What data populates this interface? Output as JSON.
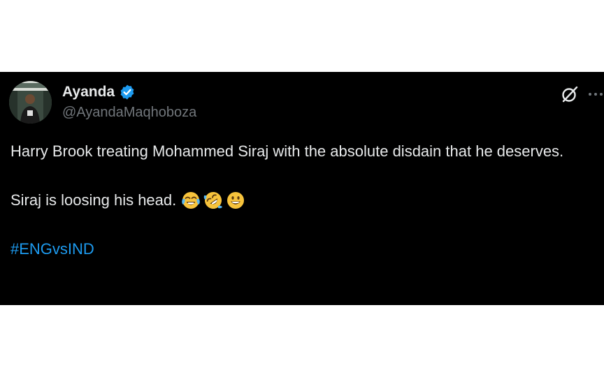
{
  "user": {
    "display_name": "Ayanda",
    "handle": "@AyandaMaqhoboza",
    "verified": true,
    "verified_color": "#1d9bf0"
  },
  "icons": [
    "verified-badge-icon",
    "grok-icon",
    "more-icon"
  ],
  "tweet": {
    "line1": "Harry Brook treating Mohammed Siraj with the absolute disdain that he deserves.",
    "line2": "Siraj is loosing his head.",
    "emojis": [
      "face-with-tears-of-joy",
      "rolling-on-the-floor-laughing",
      "grinning-face"
    ],
    "hashtag": "#ENGvsIND"
  },
  "colors": {
    "background": "#000000",
    "text": "#e7e9ea",
    "secondary": "#71767b",
    "link": "#1d9bf0"
  }
}
